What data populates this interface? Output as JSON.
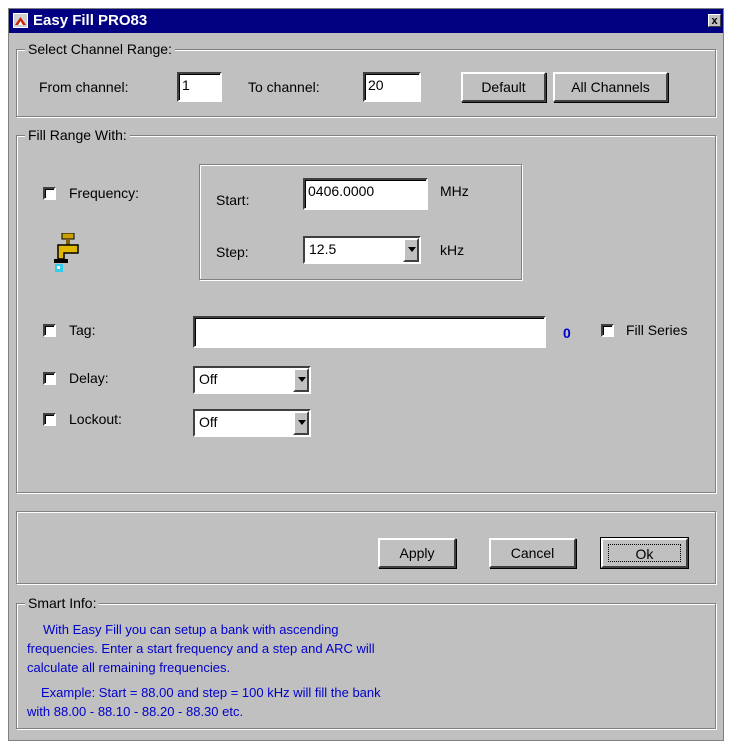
{
  "window": {
    "title": "Easy Fill PRO83",
    "close": "x"
  },
  "channel_range": {
    "legend": "Select Channel Range:",
    "from_label": "From channel:",
    "from_value": "1",
    "to_label": "To channel:",
    "to_value": "20",
    "default_label": "Default",
    "all_label": "All Channels"
  },
  "fill_range": {
    "legend": "Fill Range With:",
    "frequency_label": "Frequency:",
    "start_label": "Start:",
    "start_value": "0406.0000",
    "start_unit": "MHz",
    "step_label": "Step:",
    "step_value": "12.5",
    "step_unit": "kHz",
    "tag_label": "Tag:",
    "tag_value": "",
    "tag_count": "0",
    "fill_series_label": "Fill Series",
    "delay_label": "Delay:",
    "delay_value": "Off",
    "lockout_label": "Lockout:",
    "lockout_value": "Off",
    "icon": "faucet-icon"
  },
  "actions": {
    "apply": "Apply",
    "cancel": "Cancel",
    "ok": "Ok"
  },
  "smart_info": {
    "legend": "Smart Info:",
    "lines1": [
      "With Easy Fill you can setup a bank with ascending",
      "frequencies. Enter a start frequency and a step and ARC will",
      "calculate all remaining frequencies."
    ],
    "lines2": [
      "Example: Start = 88.00 and step = 100 kHz will fill the bank",
      "with 88.00 - 88.10 - 88.20 - 88.30 etc."
    ]
  },
  "colors": {
    "titlebar": "#000080",
    "dialog": "#c0c0c0",
    "info_text": "#0000cc"
  }
}
